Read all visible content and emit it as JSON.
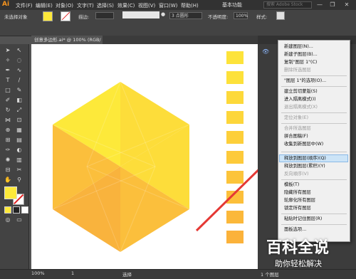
{
  "app": {
    "logo": "Ai"
  },
  "menu": [
    "文件(F)",
    "编辑(E)",
    "对象(O)",
    "文字(T)",
    "选择(S)",
    "效果(C)",
    "视图(V)",
    "窗口(W)",
    "帮助(H)"
  ],
  "workspace": "基本功能",
  "search_placeholder": "搜索 Adobe Stock",
  "window_buttons": [
    "—",
    "❐",
    "✕"
  ],
  "control_bar": {
    "no_selection": "未选择对象",
    "stroke_label": "描边:",
    "stroke_weight": "3 点圆形",
    "opacity_label": "不透明度:",
    "opacity_value": "100%",
    "style_label": "样式:",
    "colors": {
      "fill": "#fde93a",
      "stroke_slash": "#e02020"
    }
  },
  "document_tab": "创意多边形.ai* @ 100% (RGB/预览)",
  "status": {
    "zoom": "100%",
    "page": "1",
    "mode": "选择",
    "layer": "1 个图层"
  },
  "swatch_colors": [
    "#fde33a",
    "#fde13a",
    "#fdd93a",
    "#fdd63a",
    "#fdcf3a",
    "#fdca3a",
    "#fcc43a",
    "#fcbf3a",
    "#fbb83a",
    "#fbb23a"
  ],
  "hexagon_colors": {
    "light": "#fde93a",
    "mid": "#fddd3a",
    "dark": "#fbbf3c",
    "darker": "#f9b33d"
  },
  "context_menu": {
    "items": [
      {
        "label": "新建图层(N)...",
        "disabled": false
      },
      {
        "label": "新建子图层(B)...",
        "disabled": false
      },
      {
        "label": "复制\"图层 1\"(C)",
        "disabled": false
      },
      {
        "label": "删除所选图层",
        "disabled": true
      },
      {
        "label": "\"图层 1\"的选项(O)...",
        "disabled": false
      },
      {
        "label": "建立剪切蒙版(S)",
        "disabled": false
      },
      {
        "label": "进入隔离模式(I)",
        "disabled": false
      },
      {
        "label": "退出隔离模式(X)",
        "disabled": true
      },
      {
        "label": "定位对象(E)",
        "disabled": true
      },
      {
        "label": "合并所选图层",
        "disabled": true
      },
      {
        "label": "拼合图稿(F)",
        "disabled": false
      },
      {
        "label": "收集到新图层中(W)",
        "disabled": false
      },
      {
        "label": "释放到图层(顺序)(Q)",
        "disabled": false,
        "highlighted": true
      },
      {
        "label": "释放到图层(累积)(Y)",
        "disabled": false
      },
      {
        "label": "反向顺序(V)",
        "disabled": true
      },
      {
        "label": "模板(T)",
        "disabled": false
      },
      {
        "label": "隐藏所有图层",
        "disabled": false
      },
      {
        "label": "轮廓化所有图层",
        "disabled": false
      },
      {
        "label": "锁定所有图层",
        "disabled": false
      },
      {
        "label": "粘贴时记住图层(R)",
        "disabled": false
      },
      {
        "label": "面板选项...",
        "disabled": false
      }
    ]
  },
  "watermark": {
    "big": "百科全说",
    "small": "助你轻松解决"
  }
}
